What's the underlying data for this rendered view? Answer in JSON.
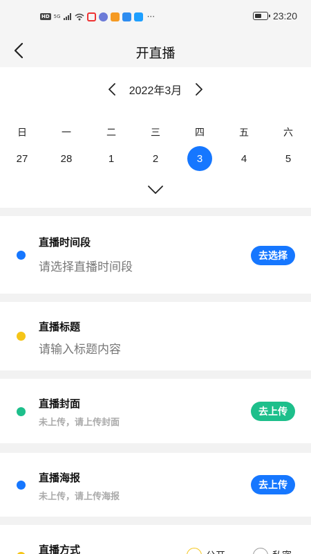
{
  "status_bar": {
    "left_badges": [
      "HD",
      "5G"
    ],
    "time": "23:20",
    "more": "···"
  },
  "nav": {
    "title": "开直播"
  },
  "calendar": {
    "month_label": "2022年3月",
    "weekdays": [
      "日",
      "一",
      "二",
      "三",
      "四",
      "五",
      "六"
    ],
    "days": [
      "27",
      "28",
      "1",
      "2",
      "3",
      "4",
      "5"
    ],
    "selected_day": "3"
  },
  "colors": {
    "accent_blue": "#1677ff",
    "green": "#1dbf8b",
    "yellow": "#f5c518"
  },
  "cards": {
    "time_slot": {
      "title": "直播时间段",
      "placeholder": "请选择直播时间段",
      "button": "去选择"
    },
    "live_title": {
      "title": "直播标题",
      "placeholder": "请输入标题内容"
    },
    "cover": {
      "title": "直播封面",
      "status": "未上传，请上传封面",
      "button": "去上传"
    },
    "poster": {
      "title": "直播海报",
      "status": "未上传，请上传海报",
      "button": "去上传"
    },
    "mode": {
      "title": "直播方式",
      "option_1": "公开",
      "option_2": "私密"
    }
  }
}
